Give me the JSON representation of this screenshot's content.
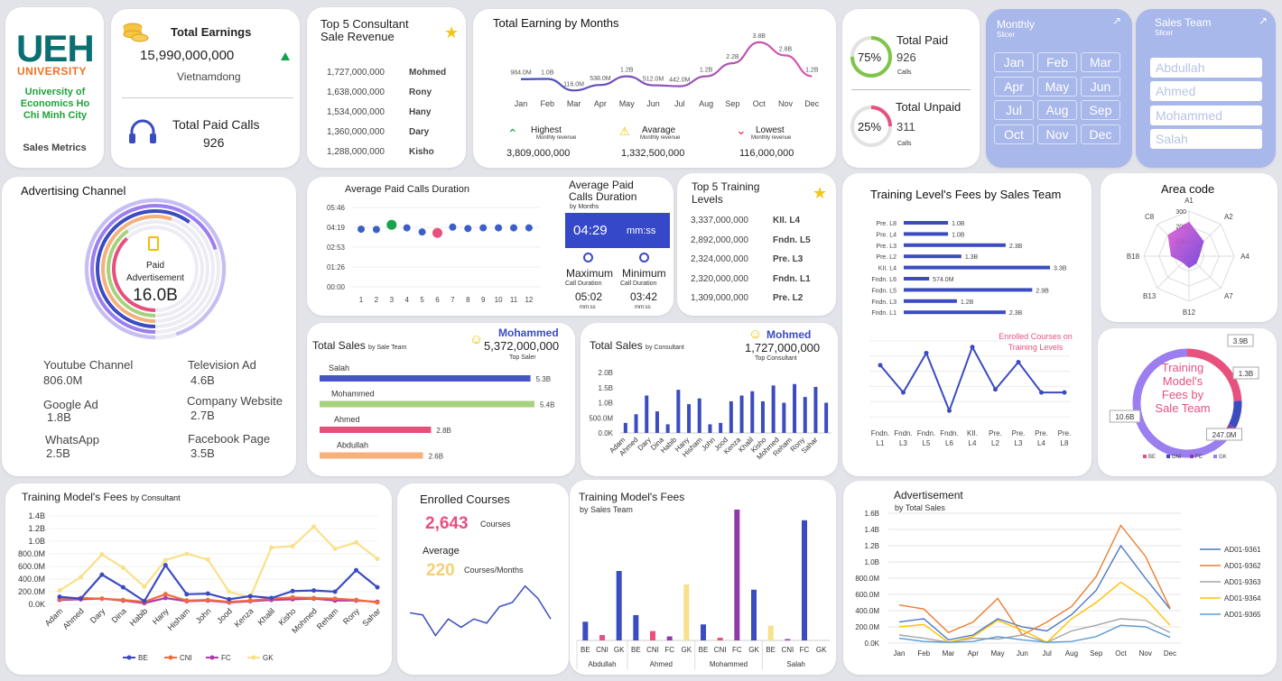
{
  "logo": {
    "text": "UEH",
    "sub": "UNIVERSITY",
    "uni": "University of Economics Ho Chi Minh City",
    "tag": "Sales Metrics"
  },
  "earnings": {
    "title": "Total Earnings",
    "value": "15,990,000,000",
    "unit": "Vietnamdong",
    "calls_title": "Total Paid Calls",
    "calls_value": "926"
  },
  "top5cons": {
    "title": "Top 5 Consultant Sale Revenue",
    "rows": [
      {
        "v": "1,727,000,000",
        "n": "Mohmed"
      },
      {
        "v": "1,638,000,000",
        "n": "Rony"
      },
      {
        "v": "1,534,000,000",
        "n": "Hany"
      },
      {
        "v": "1,360,000,000",
        "n": "Dary"
      },
      {
        "v": "1,288,000,000",
        "n": "Kisho"
      }
    ]
  },
  "months": [
    "Jan",
    "Feb",
    "Mar",
    "Apr",
    "May",
    "Jun",
    "Jul",
    "Aug",
    "Sep",
    "Oct",
    "Nov",
    "Dec"
  ],
  "earnMonths": {
    "title": "Total Earning by Months",
    "labels": [
      "984.0M",
      "1.0B",
      "116.0M",
      "538.0M",
      "1.2B",
      "512.0M",
      "442.0M",
      "1.2B",
      "2.2B",
      "3.8B",
      "2.8B",
      "1.2B"
    ],
    "highest_label": "Highest",
    "highest_sub": "Monthly revenue",
    "highest_value": "3,809,000,000",
    "average_label": "Avarage",
    "average_sub": "Monthly revenue",
    "average_value": "1,332,500,000",
    "lowest_label": "Lowest",
    "lowest_sub": "Monthly revenue",
    "lowest_value": "116,000,000"
  },
  "paid": {
    "title": "Total Paid",
    "value": "926",
    "unit": "Calls",
    "pct": "75%",
    "pctv": 0.75,
    "untitle": "Total Unpaid",
    "unvalue": "311",
    "ununit": "Calls",
    "unpct": "25%",
    "unpctv": 0.25
  },
  "monthlySlicer": {
    "title": "Monthly",
    "sub": "Slicer"
  },
  "salesSlicer": {
    "title": "Sales Team",
    "sub": "Slicer",
    "items": [
      "Abdullah",
      "Ahmed",
      "Mohammed",
      "Salah"
    ]
  },
  "adv": {
    "title": "Advertising Channel",
    "center1": "Paid",
    "center2": "Advertisement",
    "center3": "16.0B",
    "items": [
      {
        "n": "Youtube Channel",
        "v": "806.0M"
      },
      {
        "n": "Television Ad",
        "v": "4.6B"
      },
      {
        "n": "Google Ad",
        "v": "1.8B"
      },
      {
        "n": "Company Website",
        "v": "2.7B"
      },
      {
        "n": "WhatsApp",
        "v": "2.5B"
      },
      {
        "n": "Facebook Page",
        "v": "3.5B"
      }
    ]
  },
  "avgdur": {
    "title": "Average Paid Calls Duration",
    "title2a": "Average Paid",
    "title2b": "Calls Duration",
    "by": "by Months",
    "value": "04:29",
    "unit": "mm:ss",
    "max_label": "Maximum",
    "max_sub": "Call Duration",
    "max_value": "05:02",
    "min_label": "Minimum",
    "min_sub": "Call Duration",
    "min_value": "03:42",
    "mmss": "mm:ss"
  },
  "top5train": {
    "title": "Top 5 Training Levels",
    "rows": [
      {
        "v": "3,337,000,000",
        "n": "KII. L4"
      },
      {
        "v": "2,892,000,000",
        "n": "Fndn. L5"
      },
      {
        "v": "2,324,000,000",
        "n": "Pre. L3"
      },
      {
        "v": "2,320,000,000",
        "n": "Fndn. L1"
      },
      {
        "v": "1,309,000,000",
        "n": "Pre. L2"
      }
    ]
  },
  "trainLevel": {
    "title": "Training Level's Fees by Sales Team",
    "annot": "Enrolled Courses on Training Levels"
  },
  "area": {
    "title": "Area code"
  },
  "salesTeam": {
    "title": "Total Sales",
    "by": "by Sale Team",
    "top_name": "Mohammed",
    "top_value": "5,372,000,000",
    "top_label": "Top Saler"
  },
  "salesCons": {
    "title": "Total Sales",
    "by": "by Consultant",
    "top_name": "Mohmed",
    "top_value": "1,727,000,000",
    "top_label": "Top Consultant"
  },
  "trainDonut": {
    "title": "Training Model's Fees by Sale Team",
    "labels": [
      "3.9B",
      "1.3B",
      "247.0M",
      "10.6B"
    ]
  },
  "feesCons": {
    "title": "Training Model's Fees",
    "by": "by Consultant"
  },
  "enrolled": {
    "title": "Enrolled Courses",
    "value": "2,643",
    "unit": "Courses",
    "avg_label": "Average",
    "avg_value": "220",
    "avg_unit": "Courses/Months"
  },
  "feesTeam": {
    "title": "Training Model's Fees",
    "by": "by Sales Team"
  },
  "advert": {
    "title": "Advertisement",
    "by": "by Total Sales"
  },
  "chart_data": [
    {
      "type": "line",
      "id": "earning_by_months",
      "categories": [
        "Jan",
        "Feb",
        "Mar",
        "Apr",
        "May",
        "Jun",
        "Jul",
        "Aug",
        "Sep",
        "Oct",
        "Nov",
        "Dec"
      ],
      "values": [
        0.984,
        1.0,
        0.116,
        0.538,
        1.2,
        0.512,
        0.442,
        1.2,
        2.2,
        3.8,
        2.8,
        1.2
      ],
      "ylabel": "",
      "ylim": [
        0,
        4
      ]
    },
    {
      "type": "scatter",
      "id": "avg_paid_calls_duration",
      "x": [
        1,
        2,
        3,
        4,
        5,
        6,
        7,
        8,
        9,
        10,
        11,
        12
      ],
      "values": [
        4.19,
        4.17,
        4.51,
        4.29,
        3.99,
        3.92,
        4.34,
        4.24,
        4.29,
        4.29,
        4.29,
        4.29
      ],
      "yticks": [
        "05:46",
        "04:19",
        "02:53",
        "01:26",
        "00:00"
      ],
      "ylim": [
        0,
        5.77
      ],
      "highlight": {
        "max": 3,
        "min": 6
      }
    },
    {
      "type": "bar",
      "id": "total_sales_by_team",
      "categories": [
        "Salah",
        "Mohammed",
        "Ahmed",
        "Abdullah"
      ],
      "values": [
        5.3,
        5.4,
        2.8,
        2.6
      ],
      "labels": [
        "5.3B",
        "5.4B",
        "2.8B",
        "2.6B"
      ],
      "colors": [
        "#4556c2",
        "#a6d27e",
        "#e4507a",
        "#f5b07c"
      ]
    },
    {
      "type": "bar",
      "id": "total_sales_by_consultant",
      "categories": [
        "Adam",
        "Ahmed",
        "Dary",
        "Dina",
        "Habib",
        "Hany",
        "Hisham",
        "John",
        "Jood",
        "Kenza",
        "Khalil",
        "Kisho",
        "Mohmed",
        "Reham",
        "Rony",
        "Sahar"
      ],
      "values": [
        0.35,
        0.65,
        1.3,
        0.75,
        0.3,
        1.5,
        1.0,
        1.2,
        0.3,
        0.35,
        1.1,
        1.3,
        1.45,
        1.1,
        1.65,
        1.05,
        1.7,
        1.25,
        1.6,
        1.05
      ],
      "yticks": [
        "0.0K",
        "500.0M",
        "1.0B",
        "1.5B",
        "2.0B"
      ],
      "ylim": [
        0,
        2.1
      ]
    },
    {
      "type": "bar",
      "id": "training_level_fees",
      "categories": [
        "Pre. L8",
        "Pre. L4",
        "Pre. L3",
        "Pre. L2",
        "KII. L4",
        "Fndn. L6",
        "Fndn. L5",
        "Fndn. L3",
        "Fndn. L1"
      ],
      "values": [
        1.0,
        1.0,
        2.3,
        1.3,
        3.3,
        0.574,
        2.9,
        1.2,
        2.3
      ],
      "labels": [
        "1.0B",
        "1.0B",
        "2.3B",
        "1.3B",
        "3.3B",
        "574.0M",
        "2.9B",
        "1.2B",
        "2.3B"
      ]
    },
    {
      "type": "line",
      "id": "enrolled_on_levels",
      "categories": [
        "Fndn. L1",
        "Fndn. L3",
        "Fndn. L5",
        "Fndn. L6",
        "KII. L4",
        "Pre. L2",
        "Pre. L3",
        "Pre. L4",
        "Pre. L8"
      ],
      "values": [
        320,
        230,
        360,
        170,
        380,
        240,
        330,
        230,
        230
      ],
      "ylim": [
        150,
        400
      ]
    },
    {
      "type": "radar",
      "id": "area_code",
      "categories": [
        "A1",
        "A2",
        "A4",
        "A7",
        "B12",
        "B13",
        "B18",
        "C8"
      ],
      "values": [
        230,
        140,
        70,
        70,
        80,
        60,
        120,
        200
      ],
      "rticks": [
        "100",
        "200",
        "300"
      ],
      "rmax": 300
    },
    {
      "type": "pie",
      "id": "fees_by_team",
      "categories": [
        "BE",
        "CNI",
        "FC",
        "GK"
      ],
      "values": [
        3.9,
        1.3,
        0.247,
        10.6
      ],
      "labels": [
        "3.9B",
        "1.3B",
        "247.0M",
        "10.6B"
      ],
      "colors": [
        "#e8507e",
        "#3b4cc0",
        "#8e3ba8",
        "#9b7ef0"
      ]
    },
    {
      "type": "line",
      "id": "fees_by_consultant",
      "categories": [
        "Adam",
        "Ahmed",
        "Dary",
        "Dina",
        "Habib",
        "Hany",
        "Hisham",
        "John",
        "Jood",
        "Kenza",
        "Khalil",
        "Kisho",
        "Mohmed",
        "Reham",
        "Rony",
        "Sahar"
      ],
      "series": [
        {
          "name": "BE",
          "color": "#3b4cc0",
          "values": [
            120,
            90,
            470,
            270,
            50,
            620,
            160,
            170,
            80,
            130,
            100,
            210,
            220,
            200,
            540,
            270
          ]
        },
        {
          "name": "CNI",
          "color": "#f26b3a",
          "values": [
            80,
            100,
            90,
            70,
            40,
            160,
            60,
            70,
            40,
            60,
            90,
            110,
            100,
            90,
            70,
            30
          ]
        },
        {
          "name": "FC",
          "color": "#b03aa8",
          "values": [
            70,
            80,
            90,
            60,
            20,
            100,
            50,
            60,
            30,
            50,
            70,
            80,
            90,
            60,
            60,
            40
          ]
        },
        {
          "name": "GK",
          "color": "#f9e08a",
          "values": [
            220,
            430,
            790,
            580,
            280,
            700,
            800,
            710,
            200,
            110,
            900,
            920,
            1230,
            880,
            980,
            720
          ]
        }
      ],
      "yticks": [
        "0.0K",
        "200.0M",
        "400.0M",
        "600.0M",
        "800.0M",
        "1.0B",
        "1.2B",
        "1.4B"
      ],
      "ylim": [
        0,
        1400
      ]
    },
    {
      "type": "line",
      "id": "enrolled_courses_sparkline",
      "values": [
        230,
        220,
        120,
        200,
        160,
        200,
        180,
        260,
        280,
        360,
        300,
        200
      ],
      "ylim": [
        0,
        420
      ]
    },
    {
      "type": "bar",
      "id": "fees_by_sales_team",
      "categories": [
        "Abdullah",
        "Ahmed",
        "Mohammed",
        "Salah"
      ],
      "subcategories": [
        "BE",
        "CNI",
        "GK",
        "BE",
        "CNI",
        "FC",
        "GK",
        "BE",
        "CNI",
        "FC",
        "GK",
        "BE",
        "CNI",
        "FC",
        "GK"
      ],
      "values": [
        0.7,
        0.2,
        2.6,
        0.95,
        0.35,
        0.15,
        2.1,
        0.6,
        0.1,
        4.9,
        1.9,
        0.55,
        0.05,
        4.5
      ],
      "colors": [
        "#3b4cc0",
        "#e8507e",
        "#3b4cc0",
        "#3b4cc0",
        "#e8507e",
        "#8e3ba8",
        "#f9e08a",
        "#3b4cc0",
        "#e8507e",
        "#8e3ba8",
        "#3b4cc0",
        "#f9e08a",
        "#8e3ba8",
        "#3b4cc0"
      ]
    },
    {
      "type": "line",
      "id": "advertisement_by_total_sales",
      "categories": [
        "Jan",
        "Feb",
        "Mar",
        "Apr",
        "May",
        "Jun",
        "Jul",
        "Aug",
        "Sep",
        "Oct",
        "Nov",
        "Dec"
      ],
      "series": [
        {
          "name": "AD01-9361",
          "color": "#4a78c9",
          "values": [
            260,
            300,
            40,
            100,
            300,
            200,
            150,
            350,
            650,
            1200,
            800,
            420
          ]
        },
        {
          "name": "AD01-9362",
          "color": "#ed7d31",
          "values": [
            470,
            420,
            130,
            260,
            550,
            100,
            260,
            450,
            820,
            1450,
            1070,
            430
          ]
        },
        {
          "name": "AD01-9363",
          "color": "#a5a5a5",
          "values": [
            100,
            60,
            10,
            60,
            50,
            100,
            10,
            150,
            220,
            300,
            280,
            130
          ]
        },
        {
          "name": "AD01-9364",
          "color": "#ffc000",
          "values": [
            200,
            230,
            10,
            80,
            280,
            160,
            10,
            300,
            500,
            750,
            550,
            220
          ]
        },
        {
          "name": "AD01-9365",
          "color": "#5b9bd5",
          "values": [
            60,
            20,
            10,
            20,
            80,
            40,
            10,
            20,
            80,
            220,
            200,
            70
          ]
        }
      ],
      "yticks": [
        "0.0K",
        "200.0M",
        "400.0M",
        "600.0M",
        "800.0M",
        "1.0B",
        "1.2B",
        "1.4B",
        "1.6B"
      ],
      "ylim": [
        0,
        1600
      ]
    }
  ]
}
